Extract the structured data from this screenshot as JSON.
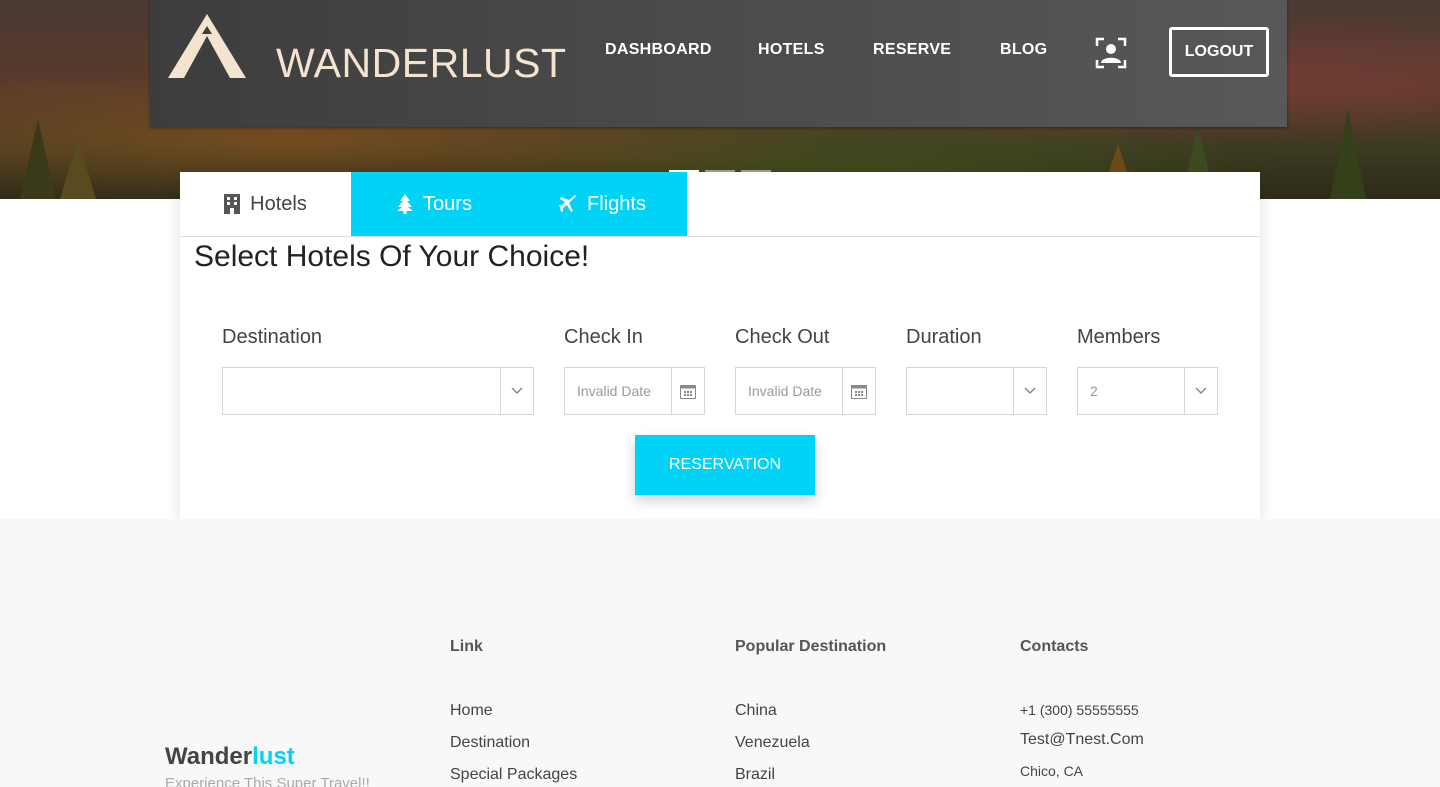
{
  "brand": {
    "name": "WANDERLUST"
  },
  "nav": {
    "links": [
      "DASHBOARD",
      "HOTELS",
      "RESERVE",
      "BLOG"
    ],
    "user_icon": "user-profile-icon",
    "logout_label": "LOGOUT"
  },
  "search": {
    "tabs": [
      {
        "label": "Hotels",
        "icon": "building-icon"
      },
      {
        "label": "Tours",
        "icon": "tree-icon"
      },
      {
        "label": "Flights",
        "icon": "plane-icon"
      }
    ],
    "title": "Select Hotels Of Your Choice!",
    "fields": {
      "destination": {
        "label": "Destination",
        "value": ""
      },
      "check_in": {
        "label": "Check In",
        "value": "Invalid Date"
      },
      "check_out": {
        "label": "Check Out",
        "value": "Invalid Date"
      },
      "duration": {
        "label": "Duration",
        "value": ""
      },
      "members": {
        "label": "Members",
        "value": "2"
      }
    },
    "button_label": "RESERVATION"
  },
  "footer": {
    "brand_part1": "Wander",
    "brand_part2": "lust",
    "tagline": "Experience This Super Travel!!",
    "link_section": {
      "heading": "Link",
      "items": [
        "Home",
        "Destination",
        "Special Packages"
      ]
    },
    "destination_section": {
      "heading": "Popular Destination",
      "items": [
        "China",
        "Venezuela",
        "Brazil"
      ]
    },
    "contacts_section": {
      "heading": "Contacts",
      "phone": "+1 (300) 55555555",
      "email": "Test@Tnest.Com",
      "location": "Chico, CA"
    }
  },
  "colors": {
    "accent": "#00d3f5",
    "navbar": "#4a4a4a",
    "brand_text": "#f3e3cf"
  }
}
